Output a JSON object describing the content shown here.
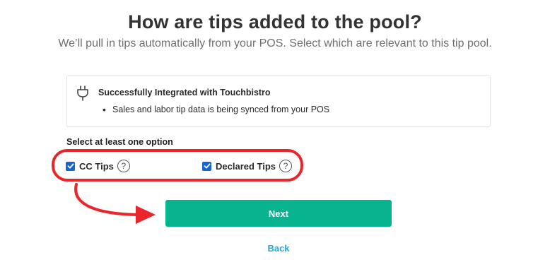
{
  "header": {
    "title": "How are tips added to the pool?",
    "subtitle": "We’ll pull in tips automatically from your POS. Select which are relevant to this tip pool."
  },
  "integration": {
    "icon": "plug-icon",
    "title": "Successfully Integrated with Touchbistro",
    "bullet": "Sales and labor tip data is being synced from your POS"
  },
  "options": {
    "prompt": "Select at least one option",
    "items": [
      {
        "label": "CC Tips",
        "checked": true,
        "help": "?"
      },
      {
        "label": "Declared Tips",
        "checked": true,
        "help": "?"
      }
    ]
  },
  "actions": {
    "next_label": "Next",
    "back_label": "Back"
  },
  "colors": {
    "primary_button": "#08b38f",
    "link": "#27a6d6",
    "checkbox": "#1565d8",
    "annotation": "#e8262b"
  }
}
